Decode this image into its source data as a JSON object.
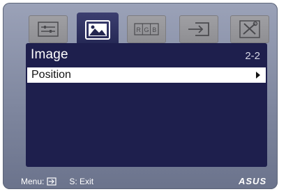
{
  "tabs": [
    {
      "name": "splendid",
      "icon": "sliders-icon",
      "active": false
    },
    {
      "name": "image",
      "icon": "image-icon",
      "active": true
    },
    {
      "name": "color",
      "icon": "rgb-icon",
      "active": false
    },
    {
      "name": "input-select",
      "icon": "input-arrow-icon",
      "active": false
    },
    {
      "name": "system-setup",
      "icon": "tools-icon",
      "active": false
    }
  ],
  "panel": {
    "title": "Image",
    "page": "2-2",
    "items": [
      {
        "label": "Position",
        "selected": true
      }
    ]
  },
  "footer": {
    "menu_label": "Menu:",
    "menu_icon": "enter-icon",
    "exit_label": "S: Exit"
  },
  "brand": {
    "text": "ASUS"
  },
  "colors": {
    "panel_bg": "#1e1f4d",
    "frame": "#8e94aa",
    "highlight": "#ffffff"
  }
}
